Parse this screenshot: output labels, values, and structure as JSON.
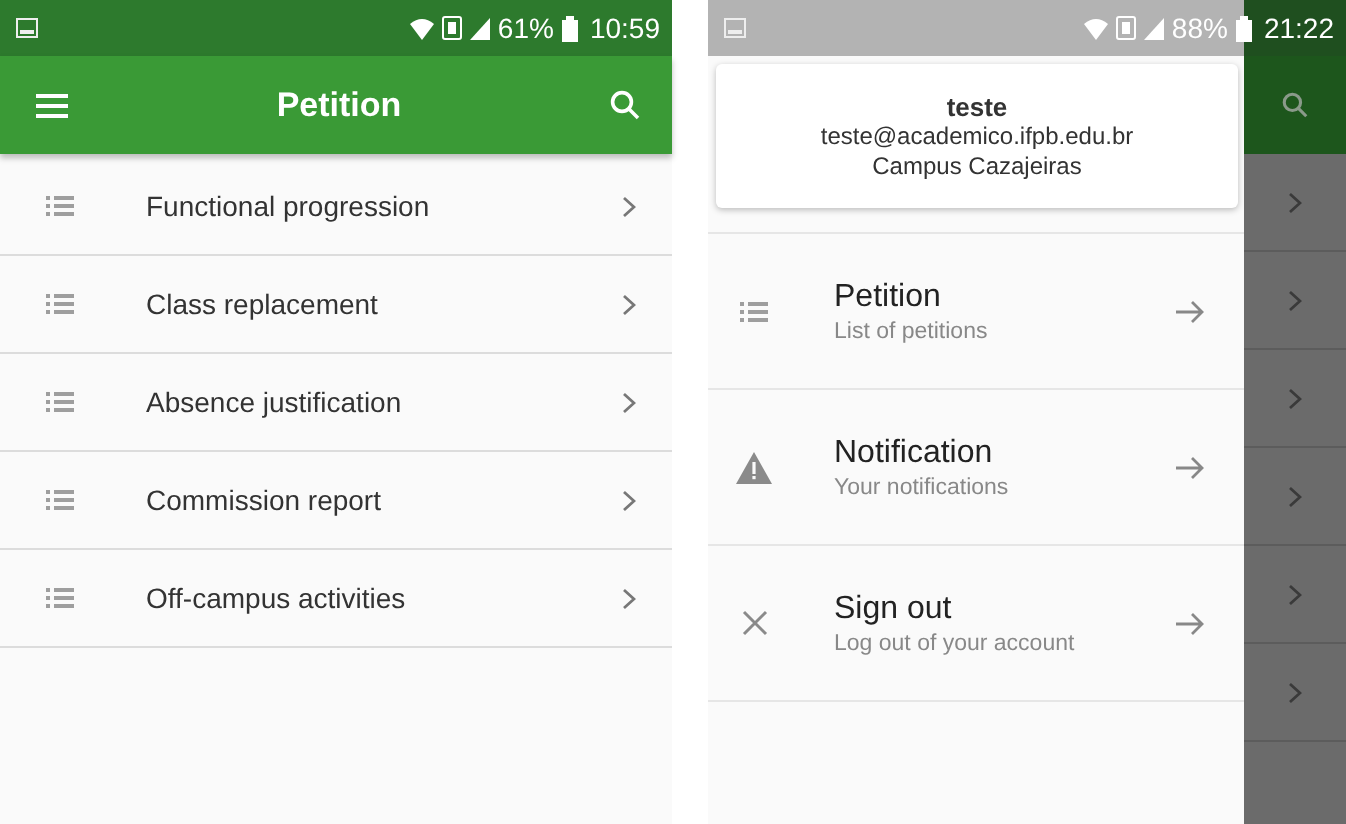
{
  "left": {
    "status": {
      "battery": "61%",
      "time": "10:59"
    },
    "app_bar": {
      "title": "Petition"
    },
    "items": [
      {
        "label": "Functional progression"
      },
      {
        "label": "Class replacement"
      },
      {
        "label": "Absence justification"
      },
      {
        "label": "Commission report"
      },
      {
        "label": "Off-campus activities"
      }
    ]
  },
  "right": {
    "status": {
      "battery": "88%",
      "time": "21:22"
    },
    "drawer": {
      "user": {
        "name": "teste",
        "email": "teste@academico.ifpb.edu.br",
        "campus": "Campus Cazajeiras"
      },
      "items": [
        {
          "kind": "list",
          "title": "Petition",
          "subtitle": "List of petitions"
        },
        {
          "kind": "warning",
          "title": "Notification",
          "subtitle": "Your notifications"
        },
        {
          "kind": "close",
          "title": "Sign out",
          "subtitle": "Log out of your account"
        }
      ]
    }
  }
}
